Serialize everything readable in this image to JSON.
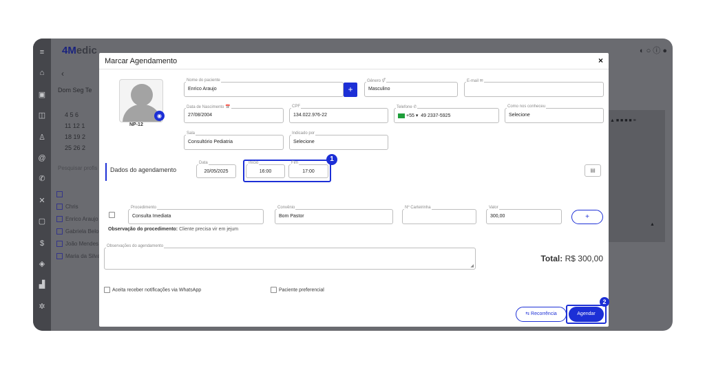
{
  "app": {
    "logo_brand": "4M",
    "logo_rest": "edic"
  },
  "background": {
    "back_arrow": "‹",
    "weekdays": "Dom  Seg  Te",
    "cal_rows": [
      "4    5    6",
      "11   12   1",
      "18   19   2",
      "25   26   2"
    ],
    "search_placeholder": "Pesquisar profis",
    "professionals": [
      "Chris",
      "Enrico Araujo",
      "Gabriela Belo",
      "João Mendes",
      "Maria da Silva"
    ]
  },
  "modal": {
    "title": "Marcar Agendamento",
    "close": "×",
    "photo_caption": "NP-12",
    "patient_name": {
      "label": "Nome do paciente",
      "value": "Enrico Araujo"
    },
    "add_patient": "+",
    "gender": {
      "label": "Gênero ⚥",
      "value": "Masculino"
    },
    "email": {
      "label": "E-mail ✉",
      "value": ""
    },
    "birth": {
      "label": "Data de Nascimento 📅",
      "value": "27/08/2004"
    },
    "cpf": {
      "label": "CPF",
      "value": "134.022.976-22"
    },
    "phone": {
      "label": "Telefone ✆",
      "country": "+55",
      "value": "49 2337-5925"
    },
    "how_met": {
      "label": "Como nos conheceu",
      "value": "Selecione"
    },
    "room": {
      "label": "Sala",
      "value": "Consultório Pediatria"
    },
    "referred": {
      "label": "Indicado por",
      "value": "Selecione"
    },
    "section_title": "Dados do agendamento",
    "date": {
      "label": "Data",
      "value": "20/05/2025"
    },
    "start": {
      "label": "Início",
      "value": "16:00"
    },
    "end": {
      "label": "Fim",
      "value": "17:00"
    },
    "badge1": "1",
    "badge2": "2",
    "procedure": {
      "label": "Procedimento",
      "value": "Consulta Imediata"
    },
    "insurance": {
      "label": "Convênio",
      "value": "Bom Pastor"
    },
    "card_number": {
      "label": "Nº Carteirinha",
      "value": ""
    },
    "amount": {
      "label": "Valor",
      "value": "300,00"
    },
    "add_procedure": "+",
    "proc_obs_label": "Observação do procedimento:",
    "proc_obs_value": "Cliente precisa vir em jejum",
    "appointment_obs_label": "Observações do agendamento",
    "total_label": "Total:",
    "total_value": "R$ 300,00",
    "whatsapp_opt": "Aceita receber notificações via WhatsApp",
    "preferential_opt": "Paciente preferencial",
    "recurrence_button": "⇆ Recorrência",
    "schedule_button": "Agendar"
  },
  "colors": {
    "accent": "#1c2fd6",
    "overlay": "#6a6b70"
  }
}
